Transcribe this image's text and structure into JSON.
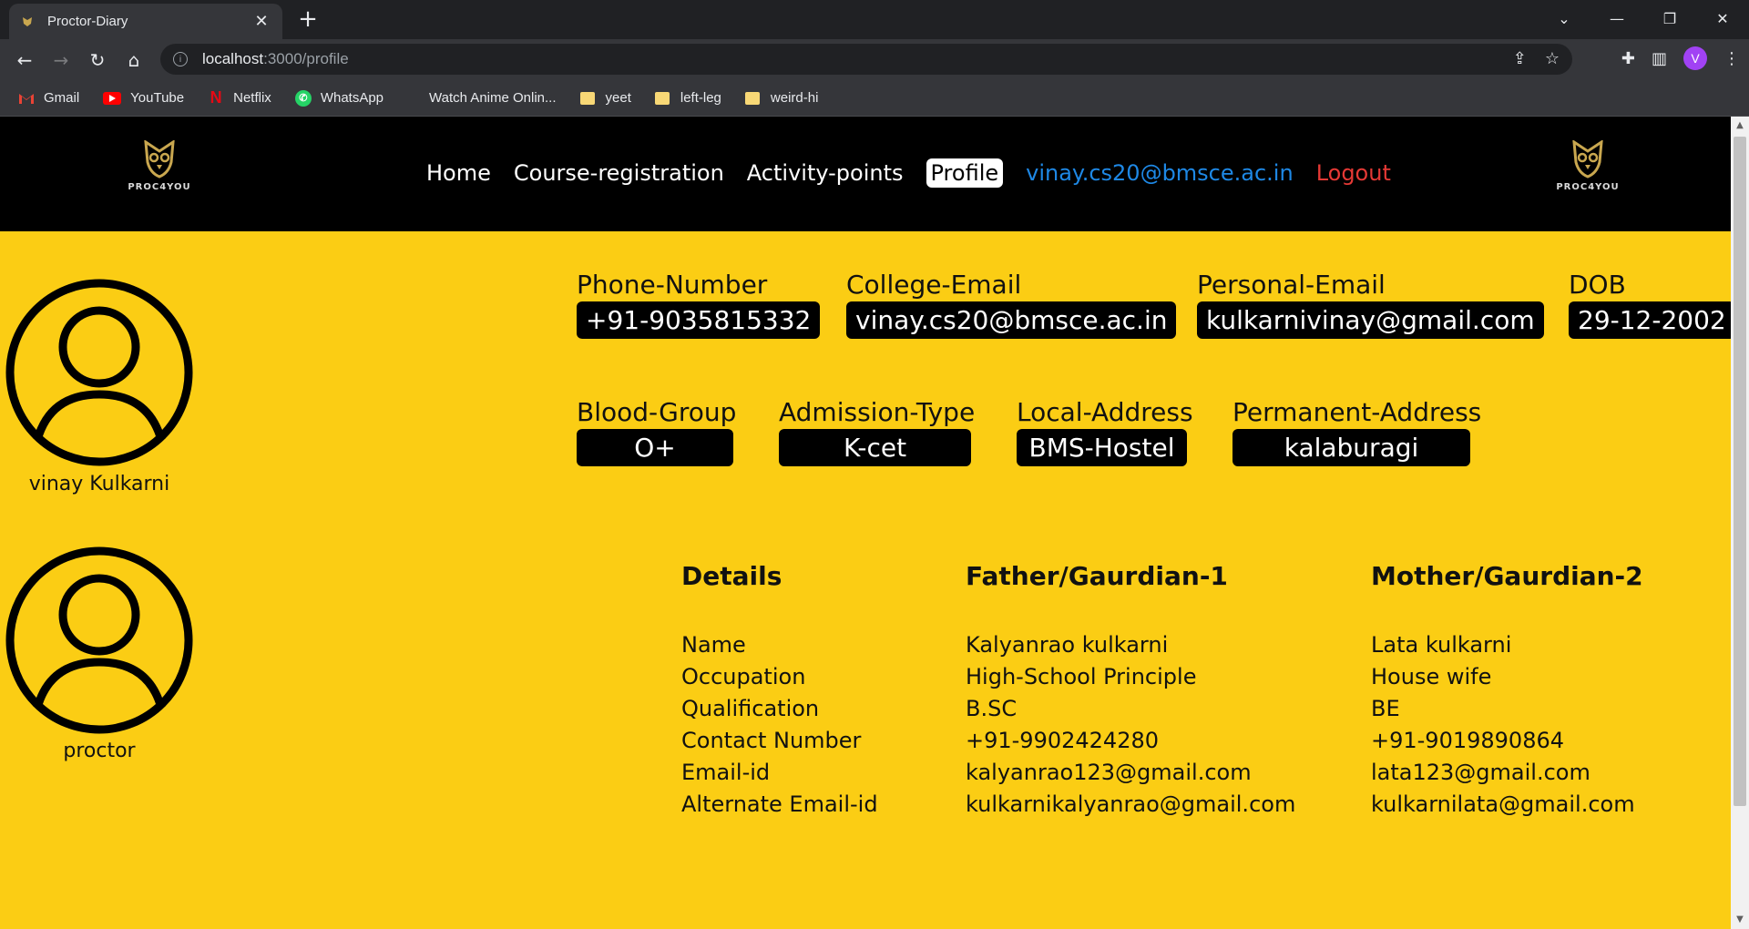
{
  "browser": {
    "tab_title": "Proctor-Diary",
    "url_host": "localhost",
    "url_path": ":3000/profile",
    "profile_initial": "V",
    "bookmarks": [
      {
        "label": "Gmail",
        "icon": "gmail-icon"
      },
      {
        "label": "YouTube",
        "icon": "youtube-icon"
      },
      {
        "label": "Netflix",
        "icon": "netflix-icon"
      },
      {
        "label": "WhatsApp",
        "icon": "whatsapp-icon"
      },
      {
        "label": "Watch Anime Onlin...",
        "icon": "none"
      },
      {
        "label": "yeet",
        "icon": "folder-icon"
      },
      {
        "label": "left-leg",
        "icon": "folder-icon"
      },
      {
        "label": "weird-hi",
        "icon": "folder-icon"
      }
    ]
  },
  "header": {
    "logo_text": "PROC4YOU",
    "nav": {
      "home": "Home",
      "course": "Course-registration",
      "activity": "Activity-points",
      "profile": "Profile",
      "email": "vinay.cs20@bmsce.ac.in",
      "logout": "Logout"
    }
  },
  "student": {
    "name": "vinay Kulkarni",
    "fields": {
      "phone": {
        "label": "Phone-Number",
        "value": "+91-9035815332"
      },
      "college_email": {
        "label": "College-Email",
        "value": "vinay.cs20@bmsce.ac.in"
      },
      "personal_email": {
        "label": "Personal-Email",
        "value": "kulkarnivinay@gmail.com"
      },
      "dob": {
        "label": "DOB",
        "value": "29-12-2002"
      },
      "blood": {
        "label": "Blood-Group",
        "value": "O+"
      },
      "admission": {
        "label": "Admission-Type",
        "value": "K-cet"
      },
      "local": {
        "label": "Local-Address",
        "value": "BMS-Hostel"
      },
      "permanent": {
        "label": "Permanent-Address",
        "value": "kalaburagi"
      }
    }
  },
  "proctor": {
    "name": "proctor"
  },
  "details": {
    "col1": {
      "head": "Details",
      "items": [
        "Name",
        "Occupation",
        "Qualification",
        "Contact Number",
        "Email-id",
        "Alternate Email-id"
      ]
    },
    "col2": {
      "head": "Father/Gaurdian-1",
      "items": [
        "Kalyanrao kulkarni",
        "High-School Principle",
        "B.SC",
        "+91-9902424280",
        "kalyanrao123@gmail.com",
        "kulkarnikalyanrao@gmail.com"
      ]
    },
    "col3": {
      "head": "Mother/Gaurdian-2",
      "items": [
        "Lata kulkarni",
        "House wife",
        "BE",
        "+91-9019890864",
        "lata123@gmail.com",
        "kulkarnilata@gmail.com"
      ]
    }
  }
}
